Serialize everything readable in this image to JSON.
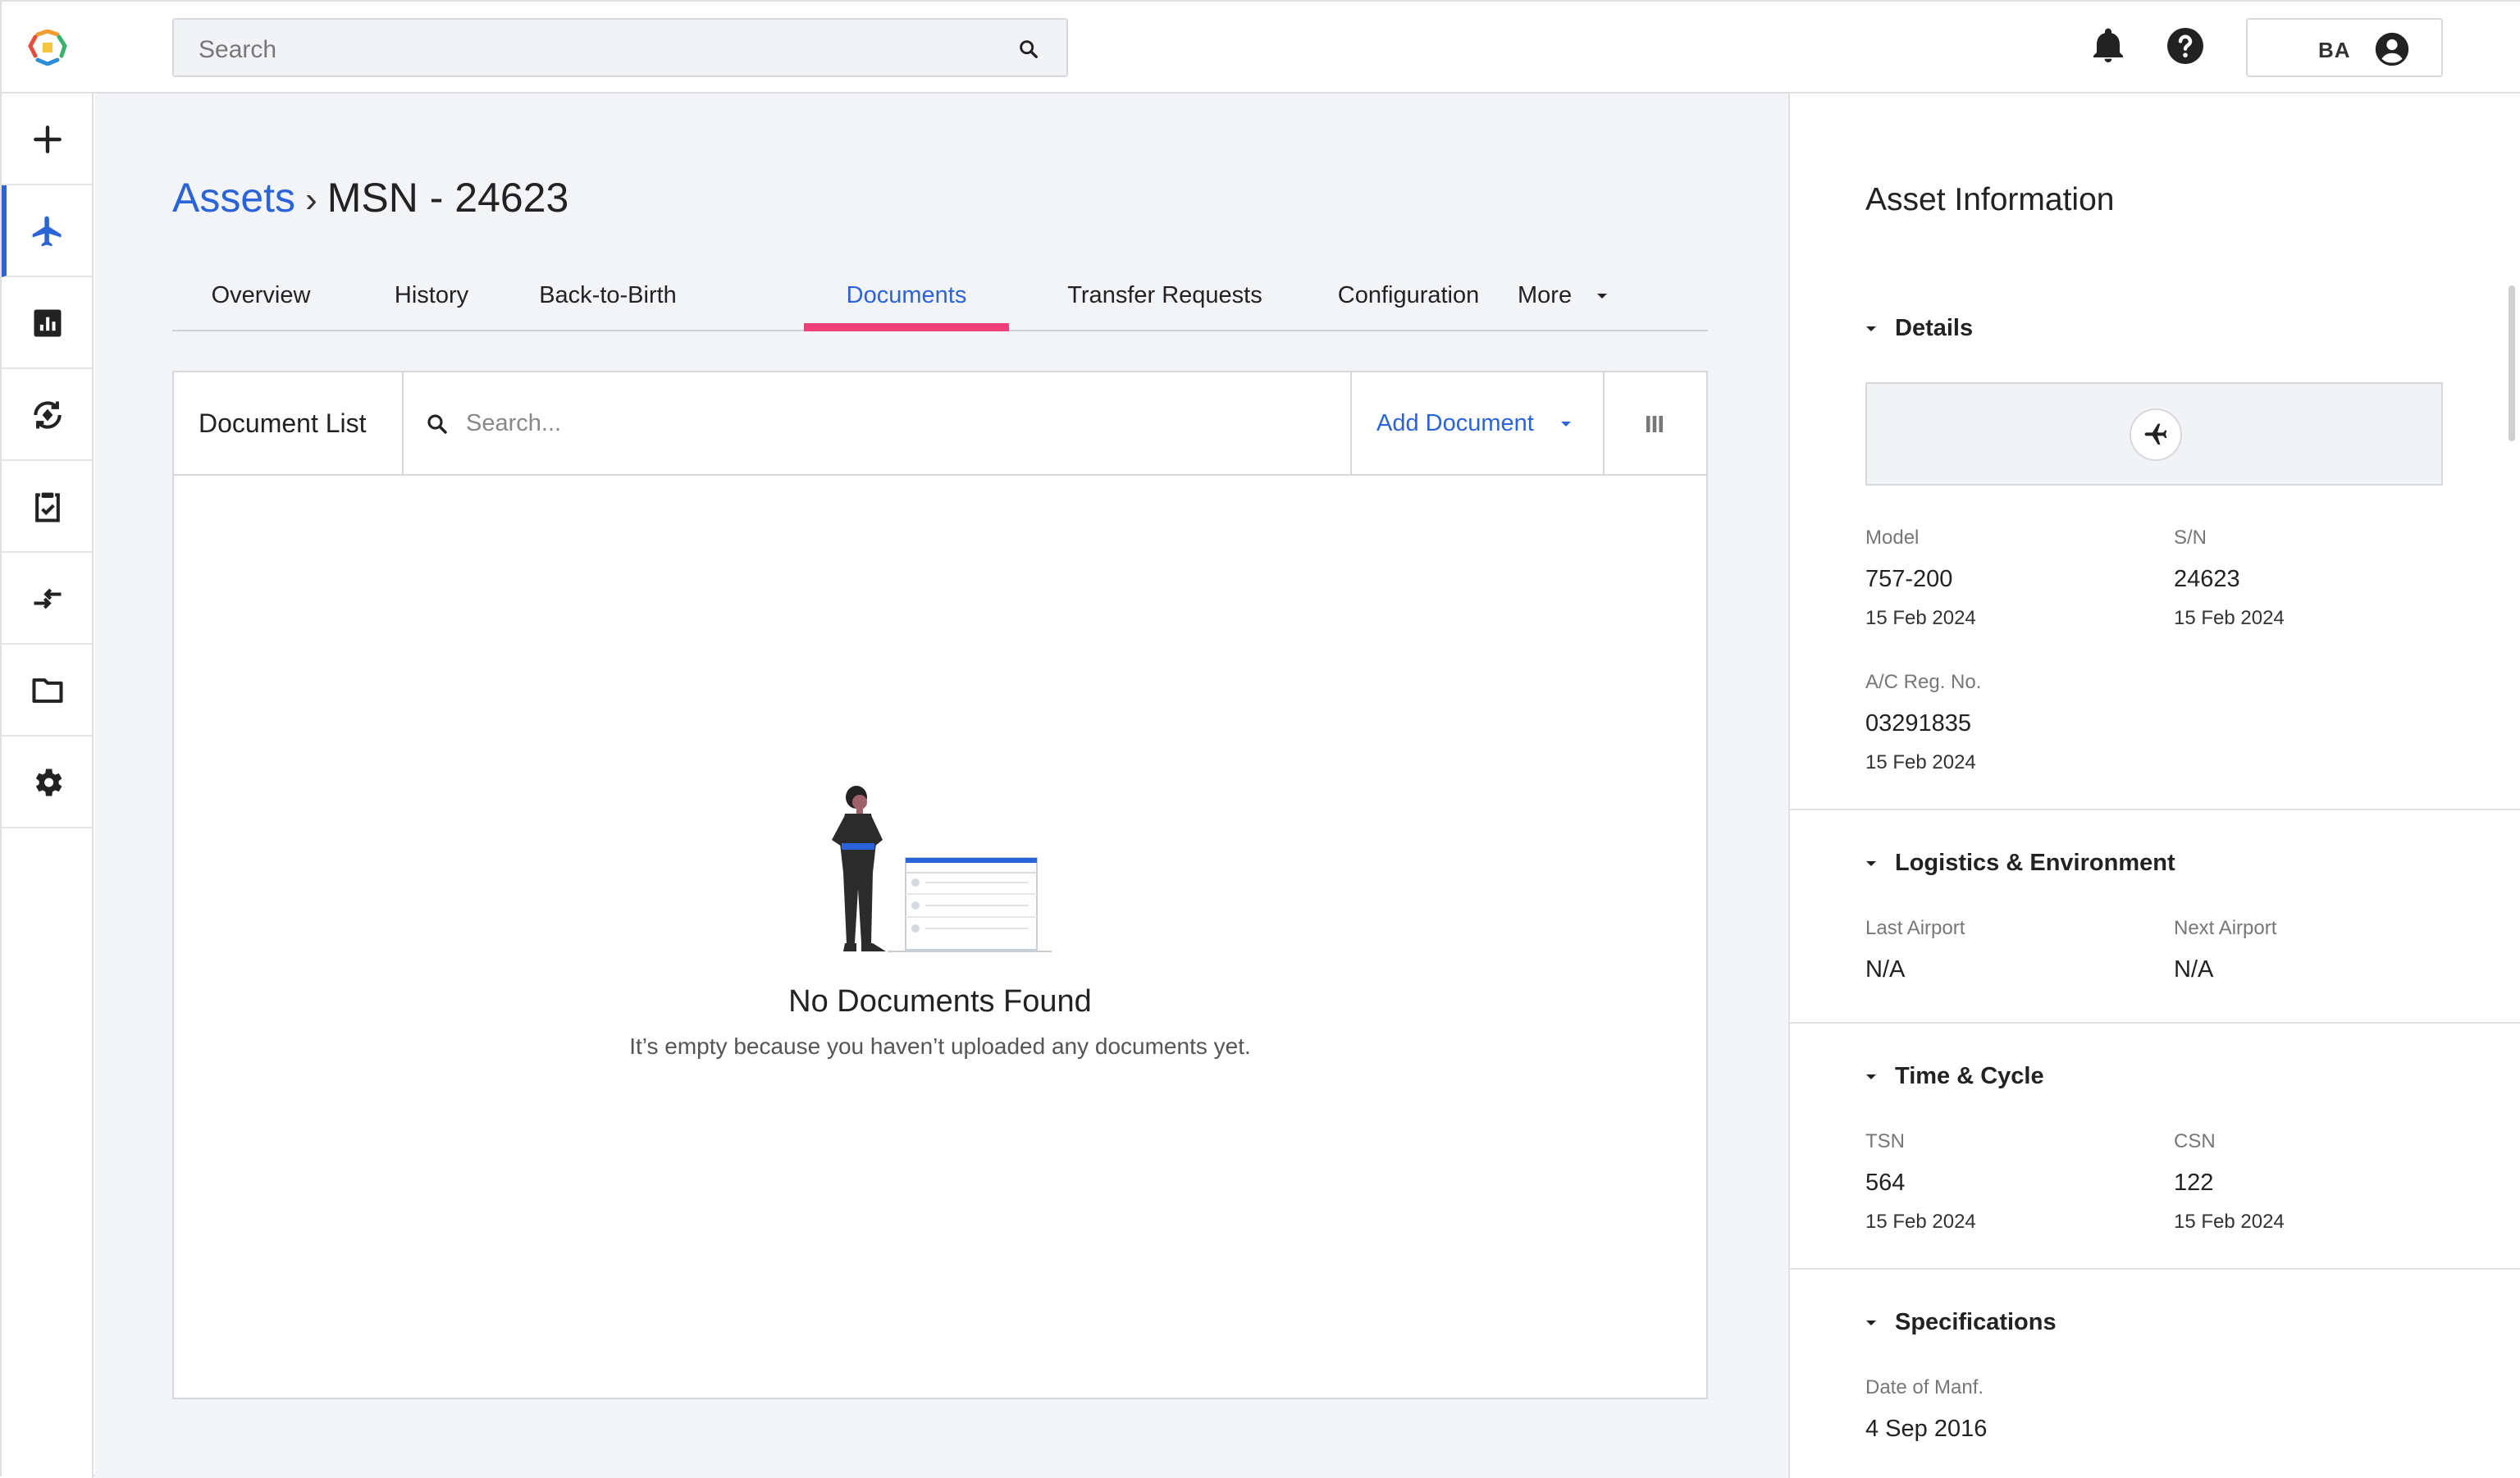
{
  "header": {
    "search_placeholder": "Search",
    "user_initials": "BA"
  },
  "sidebar": {
    "items": [
      {
        "name": "add",
        "icon": "plus-icon"
      },
      {
        "name": "assets",
        "icon": "airplane-icon",
        "active": true
      },
      {
        "name": "reports",
        "icon": "bar-chart-icon"
      },
      {
        "name": "maintenance",
        "icon": "cycle-icon"
      },
      {
        "name": "tasks",
        "icon": "clipboard-check-icon"
      },
      {
        "name": "transfers",
        "icon": "transfer-arrows-icon"
      },
      {
        "name": "documents",
        "icon": "folder-icon"
      },
      {
        "name": "settings",
        "icon": "gear-icon"
      }
    ]
  },
  "breadcrumb": {
    "root": "Assets",
    "separator": "›",
    "current": "MSN - 24623"
  },
  "tabs": [
    {
      "label": "Overview"
    },
    {
      "label": "History"
    },
    {
      "label": "Back-to-Birth"
    },
    {
      "label": "Documents",
      "active": true
    },
    {
      "label": "Transfer Requests"
    },
    {
      "label": "Configuration"
    },
    {
      "label": "More"
    }
  ],
  "document_list": {
    "title": "Document List",
    "search_placeholder": "Search...",
    "add_label": "Add Document",
    "empty_title": "No Documents Found",
    "empty_subtitle": "It’s empty because you haven’t uploaded any documents yet."
  },
  "asset_info": {
    "title": "Asset Information",
    "details": {
      "heading": "Details",
      "model_label": "Model",
      "model_value": "757-200",
      "model_date": "15 Feb 2024",
      "sn_label": "S/N",
      "sn_value": "24623",
      "sn_date": "15 Feb 2024",
      "reg_label": "A/C Reg. No.",
      "reg_value": "03291835",
      "reg_date": "15 Feb 2024"
    },
    "logistics": {
      "heading": "Logistics & Environment",
      "last_label": "Last Airport",
      "last_value": "N/A",
      "next_label": "Next Airport",
      "next_value": "N/A"
    },
    "time_cycle": {
      "heading": "Time & Cycle",
      "tsn_label": "TSN",
      "tsn_value": "564",
      "tsn_date": "15 Feb 2024",
      "csn_label": "CSN",
      "csn_value": "122",
      "csn_date": "15 Feb 2024"
    },
    "specifications": {
      "heading": "Specifications",
      "manf_label": "Date of Manf.",
      "manf_value": "4 Sep 2016"
    }
  },
  "colors": {
    "accent": "#2b63d8",
    "tab_indicator": "#f0407a"
  }
}
